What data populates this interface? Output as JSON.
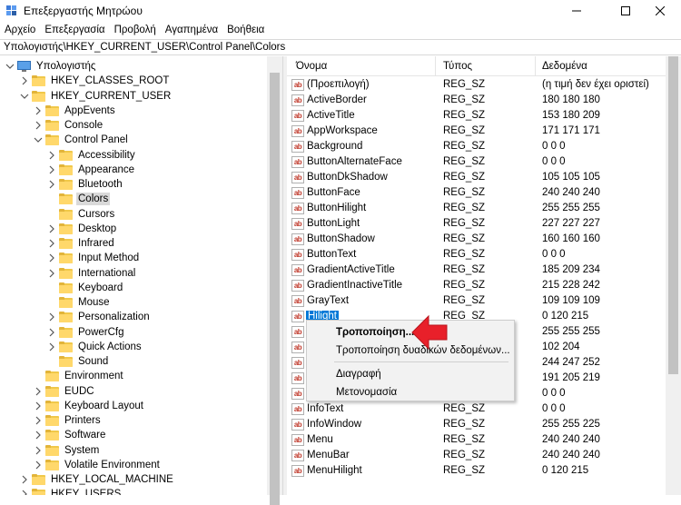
{
  "window": {
    "title": "Επεξεργαστής Μητρώου",
    "minimize_icon": "minimize-icon",
    "maximize_icon": "maximize-icon",
    "close_icon": "close-icon"
  },
  "menubar": {
    "items": [
      "Αρχείο",
      "Επεξεργασία",
      "Προβολή",
      "Αγαπημένα",
      "Βοήθεια"
    ]
  },
  "address": {
    "path": "Υπολογιστής\\HKEY_CURRENT_USER\\Control Panel\\Colors"
  },
  "tree": {
    "root": "Υπολογιστής",
    "nodes": [
      {
        "label": "HKEY_CLASSES_ROOT",
        "expanded": false
      },
      {
        "label": "HKEY_CURRENT_USER",
        "expanded": true
      },
      {
        "label": "AppEvents",
        "expanded": false
      },
      {
        "label": "Console",
        "expanded": false
      },
      {
        "label": "Control Panel",
        "expanded": true
      },
      {
        "label": "Accessibility",
        "expanded": false
      },
      {
        "label": "Appearance",
        "expanded": false
      },
      {
        "label": "Bluetooth",
        "expanded": false
      },
      {
        "label": "Colors",
        "selected": true
      },
      {
        "label": "Cursors"
      },
      {
        "label": "Desktop",
        "expanded": false
      },
      {
        "label": "Infrared",
        "expanded": false
      },
      {
        "label": "Input Method",
        "expanded": false
      },
      {
        "label": "International",
        "expanded": false
      },
      {
        "label": "Keyboard"
      },
      {
        "label": "Mouse"
      },
      {
        "label": "Personalization",
        "expanded": false
      },
      {
        "label": "PowerCfg",
        "expanded": false
      },
      {
        "label": "Quick Actions",
        "expanded": false
      },
      {
        "label": "Sound"
      },
      {
        "label": "Environment"
      },
      {
        "label": "EUDC",
        "expanded": false
      },
      {
        "label": "Keyboard Layout",
        "expanded": false
      },
      {
        "label": "Printers",
        "expanded": false
      },
      {
        "label": "Software",
        "expanded": false
      },
      {
        "label": "System",
        "expanded": false
      },
      {
        "label": "Volatile Environment",
        "expanded": false
      },
      {
        "label": "HKEY_LOCAL_MACHINE",
        "expanded": false
      },
      {
        "label": "HKEY_USERS",
        "expanded": false
      }
    ]
  },
  "values": {
    "headers": {
      "name": "Όνομα",
      "type": "Τύπος",
      "data": "Δεδομένα"
    },
    "rows": [
      {
        "name": "(Προεπιλογή)",
        "type": "REG_SZ",
        "data": "(η τιμή δεν έχει οριστεί)"
      },
      {
        "name": "ActiveBorder",
        "type": "REG_SZ",
        "data": "180 180 180"
      },
      {
        "name": "ActiveTitle",
        "type": "REG_SZ",
        "data": "153 180 209"
      },
      {
        "name": "AppWorkspace",
        "type": "REG_SZ",
        "data": "171 171 171"
      },
      {
        "name": "Background",
        "type": "REG_SZ",
        "data": "0 0 0"
      },
      {
        "name": "ButtonAlternateFace",
        "type": "REG_SZ",
        "data": "0 0 0"
      },
      {
        "name": "ButtonDkShadow",
        "type": "REG_SZ",
        "data": "105 105 105"
      },
      {
        "name": "ButtonFace",
        "type": "REG_SZ",
        "data": "240 240 240"
      },
      {
        "name": "ButtonHilight",
        "type": "REG_SZ",
        "data": "255 255 255"
      },
      {
        "name": "ButtonLight",
        "type": "REG_SZ",
        "data": "227 227 227"
      },
      {
        "name": "ButtonShadow",
        "type": "REG_SZ",
        "data": "160 160 160"
      },
      {
        "name": "ButtonText",
        "type": "REG_SZ",
        "data": "0 0 0"
      },
      {
        "name": "GradientActiveTitle",
        "type": "REG_SZ",
        "data": "185 209 234"
      },
      {
        "name": "GradientInactiveTitle",
        "type": "REG_SZ",
        "data": "215 228 242"
      },
      {
        "name": "GrayText",
        "type": "REG_SZ",
        "data": "109 109 109"
      },
      {
        "name": "Hilight",
        "type": "REG_SZ",
        "data": "0 120 215",
        "selected": true
      },
      {
        "name": "",
        "type": "",
        "data": "255 255 255"
      },
      {
        "name": "",
        "type": "",
        "data": "102 204"
      },
      {
        "name": "",
        "type": "",
        "data": "244 247 252"
      },
      {
        "name": "",
        "type": "",
        "data": "191 205 219"
      },
      {
        "name": "",
        "type": "",
        "data": "0 0 0"
      },
      {
        "name": "InfoText",
        "type": "REG_SZ",
        "data": "0 0 0"
      },
      {
        "name": "InfoWindow",
        "type": "REG_SZ",
        "data": "255 255 225"
      },
      {
        "name": "Menu",
        "type": "REG_SZ",
        "data": "240 240 240"
      },
      {
        "name": "MenuBar",
        "type": "REG_SZ",
        "data": "240 240 240"
      },
      {
        "name": "MenuHilight",
        "type": "REG_SZ",
        "data": "0 120 215"
      }
    ]
  },
  "context_menu": {
    "items": [
      {
        "label": "Τροποποίηση...",
        "bold": true
      },
      {
        "label": "Τροποποίηση δυαδικών δεδομένων..."
      },
      {
        "label": "Διαγραφή"
      },
      {
        "label": "Μετονομασία"
      }
    ]
  },
  "value_icon_text": "ab",
  "colors": {
    "selection": "#0078d7",
    "folder": "#ffd86b",
    "arrow": "#e8202a"
  }
}
